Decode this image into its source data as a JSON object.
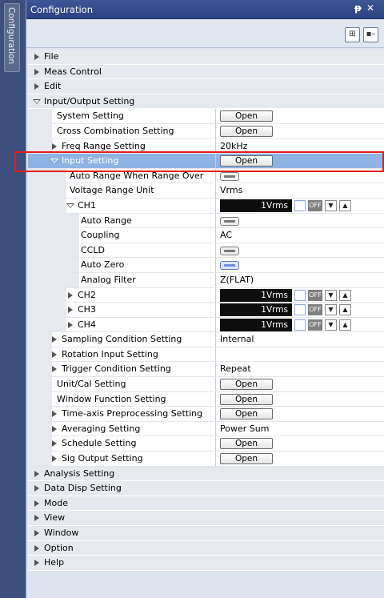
{
  "side_tab": {
    "label": "Configuration"
  },
  "window": {
    "title": "Configuration",
    "pin_icon": "pin-icon",
    "close_icon": "close-icon"
  },
  "toolbar": {
    "buttons": [
      "categorized-view-icon",
      "collapse-icon"
    ]
  },
  "tree": {
    "categories_top": [
      "File",
      "Meas Control",
      "Edit"
    ],
    "io_header": "Input/Output Setting",
    "system_setting": {
      "name": "System Setting",
      "value": "Open"
    },
    "cross_combination": {
      "name": "Cross Combination Setting",
      "value": "Open"
    },
    "freq_range": {
      "name": "Freq Range Setting",
      "value": "20kHz"
    },
    "input_setting": {
      "name": "Input Setting",
      "value": "Open"
    },
    "auto_range_over": {
      "name": "Auto Range When Range Over"
    },
    "voltage_range_unit": {
      "name": "Voltage Range Unit",
      "value": "Vrms"
    },
    "ch1": {
      "name": "CH1",
      "range": "1Vrms",
      "off": "OFF"
    },
    "ch1_props": {
      "auto_range": {
        "name": "Auto Range"
      },
      "coupling": {
        "name": "Coupling",
        "value": "AC"
      },
      "ccld": {
        "name": "CCLD"
      },
      "auto_zero": {
        "name": "Auto Zero"
      },
      "analog_filter": {
        "name": "Analog Filter",
        "value": "Z(FLAT)"
      }
    },
    "channels": [
      {
        "name": "CH2",
        "range": "1Vrms",
        "off": "OFF"
      },
      {
        "name": "CH3",
        "range": "1Vrms",
        "off": "OFF"
      },
      {
        "name": "CH4",
        "range": "1Vrms",
        "off": "OFF"
      }
    ],
    "sampling": {
      "name": "Sampling Condition Setting",
      "value": "Internal"
    },
    "rotation": {
      "name": "Rotation Input Setting"
    },
    "trigger": {
      "name": "Trigger Condition Setting",
      "value": "Repeat"
    },
    "unit_cal": {
      "name": "Unit/Cal Setting",
      "value": "Open"
    },
    "window_function": {
      "name": "Window Function Setting",
      "value": "Open"
    },
    "time_axis": {
      "name": "Time-axis Preprocessing Setting",
      "value": "Open"
    },
    "averaging": {
      "name": "Averaging Setting",
      "value": "Power Sum"
    },
    "schedule": {
      "name": "Schedule Setting",
      "value": "Open"
    },
    "sig_output": {
      "name": "Sig Output Setting",
      "value": "Open"
    },
    "categories_bottom": [
      "Analysis Setting",
      "Data Disp Setting",
      "Mode",
      "View",
      "Window",
      "Option",
      "Help"
    ]
  }
}
